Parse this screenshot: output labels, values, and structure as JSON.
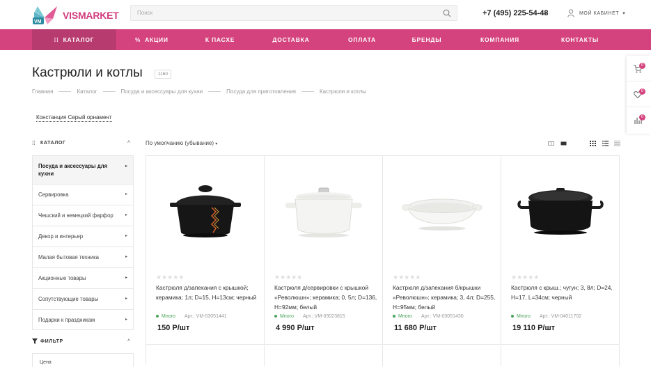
{
  "brand": {
    "logo_text": "VISMARKET",
    "logo_badge": "VM",
    "accent": "#d4437e",
    "accent_dark": "#b83b6f"
  },
  "search": {
    "placeholder": "Поиск"
  },
  "header": {
    "phone": "+7 (495) 225-54-48",
    "account_label": "Мой кабинет"
  },
  "nav": [
    {
      "label": "Каталог",
      "icon": "grid-icon",
      "active": true
    },
    {
      "label": "Акции",
      "icon": "percent-icon",
      "active": false
    },
    {
      "label": "К Пасхе",
      "active": false
    },
    {
      "label": "Доставка",
      "active": false
    },
    {
      "label": "Оплата",
      "active": false
    },
    {
      "label": "Бренды",
      "active": false
    },
    {
      "label": "Компания",
      "active": false
    },
    {
      "label": "Контакты",
      "active": false
    }
  ],
  "right_panel": [
    {
      "icon": "cart-icon",
      "badge": "0"
    },
    {
      "icon": "heart-icon",
      "badge": "0"
    },
    {
      "icon": "compare-icon",
      "badge": "0"
    }
  ],
  "page": {
    "title": "Кастрюли и котлы",
    "count": "1160",
    "breadcrumbs": [
      "Главная",
      "Каталог",
      "Посуда и аксессуары для кухни",
      "Посуда для приготовления",
      "Кастрюли и котлы"
    ],
    "tag_link": "Констанция Серый орнамент"
  },
  "sidebar": {
    "catalog_label": "Каталог",
    "items": [
      {
        "label": "Посуда и аксессуары для кухни"
      },
      {
        "label": "Сервировка"
      },
      {
        "label": "Чешский и немецкий фарфор"
      },
      {
        "label": "Декор и интерьер"
      },
      {
        "label": "Малая бытовая техника"
      },
      {
        "label": "Акционные товары"
      },
      {
        "label": "Сопутствующие товары"
      },
      {
        "label": "Подарки к праздникам"
      }
    ],
    "filter_label": "Фильтр",
    "filter_first": "Цена"
  },
  "sort": {
    "label": "По умолчанию (убывание)"
  },
  "products": [
    {
      "title": "Кастрюля д/запекания с крышкой; керамика; 1л; D=15, H=13см; черный",
      "stock": "Много",
      "article": "Арт.: VM-03051441",
      "price": "150 Р/шт",
      "rating": 0
    },
    {
      "title": "Кастрюля д/сервировки с крышкой «Революшн»; керамика; 0, 5л; D=136, H=92мм; белый",
      "stock": "Много",
      "article": "Арт.: VM-03023815",
      "price": "4 990 Р/шт",
      "rating": 0
    },
    {
      "title": "Кастрюля д/запекания б/крышки «Революшн»; керамика; 3, 4л; D=255, H=95мм; белый",
      "stock": "Много",
      "article": "Арт.: VM-03051430",
      "price": "11 680 Р/шт",
      "rating": 0
    },
    {
      "title": "Кастрюля с крыш.; чугун; 3, 8л; D=24, H=17, L=34см; черный",
      "stock": "Много",
      "article": "Арт.: VM-04011702",
      "price": "19 110 Р/шт",
      "rating": 0
    }
  ]
}
